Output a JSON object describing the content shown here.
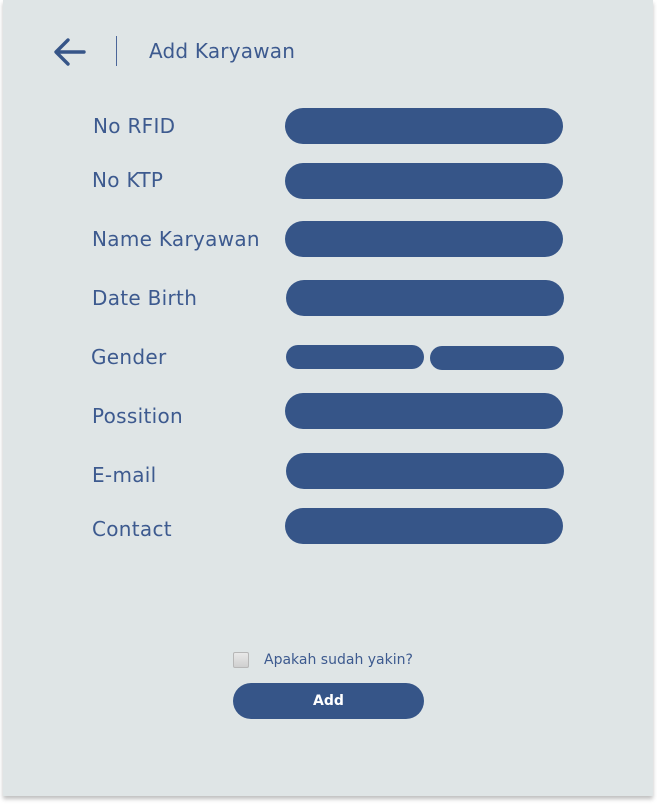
{
  "header": {
    "title": "Add Karyawan",
    "back_icon": "arrow-left-icon"
  },
  "form": {
    "fields": [
      {
        "label": "No RFID",
        "value": ""
      },
      {
        "label": "No KTP",
        "value": ""
      },
      {
        "label": "Name Karyawan",
        "value": ""
      },
      {
        "label": "Date Birth",
        "value": ""
      },
      {
        "label": "Gender",
        "options": [
          "",
          ""
        ]
      },
      {
        "label": "Possition",
        "value": ""
      },
      {
        "label": "E-mail",
        "value": ""
      },
      {
        "label": "Contact",
        "value": ""
      }
    ]
  },
  "confirm": {
    "label": "Apakah sudah yakin?",
    "checked": false
  },
  "actions": {
    "add_label": "Add"
  },
  "colors": {
    "background": "#dfe5e6",
    "accent": "#365588",
    "text": "#3d5a8f"
  }
}
